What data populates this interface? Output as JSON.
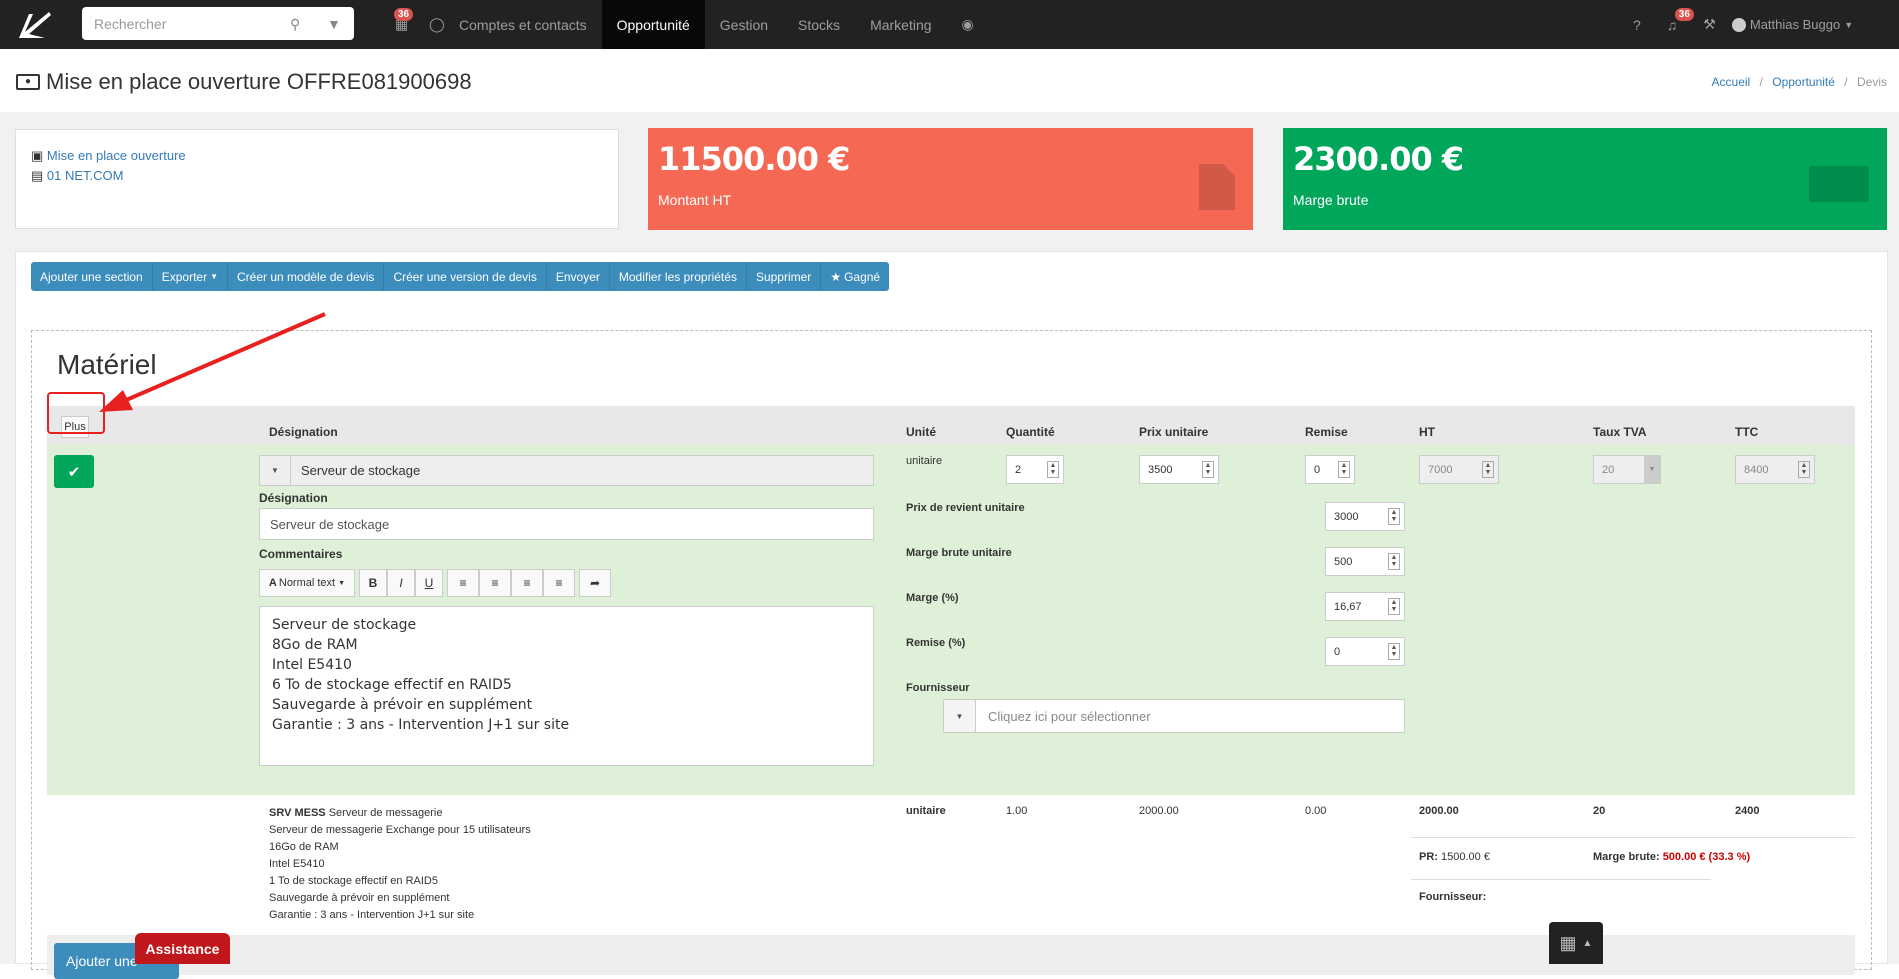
{
  "topbar": {
    "search_placeholder": "Rechercher",
    "calendar_badge": "36",
    "notif_badge": "36",
    "nav": [
      "Comptes et contacts",
      "Opportunité",
      "Gestion",
      "Stocks",
      "Marketing"
    ],
    "active_nav": "Opportunité",
    "user": "Matthias Buggo"
  },
  "header": {
    "title": "Mise en place ouverture OFFRE081900698",
    "breadcrumb": [
      "Accueil",
      "Opportunité",
      "Devis"
    ]
  },
  "info": {
    "opportunity_link": "Mise en place ouverture",
    "company_link": "01 NET.COM"
  },
  "stats": {
    "amount_value": "11500.00 €",
    "amount_label": "Montant HT",
    "amount_color": "#f56954",
    "margin_value": "2300.00 €",
    "margin_label": "Marge brute",
    "margin_color": "#00a65a"
  },
  "toolbar": {
    "buttons": [
      "Ajouter une section",
      "Exporter",
      "Créer un modèle de devis",
      "Créer une version de devis",
      "Envoyer",
      "Modifier les propriétés",
      "Supprimer",
      "Gagné"
    ]
  },
  "section": {
    "title": "Matériel",
    "plus_label": "Plus",
    "columns": [
      "Désignation",
      "Unité",
      "Quantité",
      "Prix unitaire",
      "Remise",
      "HT",
      "Taux TVA",
      "TTC"
    ]
  },
  "edit_row": {
    "product_select": "Serveur de stockage",
    "designation_label": "Désignation",
    "designation_value": "Serveur de stockage",
    "comments_label": "Commentaires",
    "rte_normal": "Normal text",
    "comment_lines": [
      "Serveur de stockage",
      "8Go de RAM",
      "Intel E5410",
      "6 To de stockage effectif en RAID5",
      "Sauvegarde à prévoir en supplément",
      "Garantie : 3 ans - Intervention J+1 sur site"
    ],
    "unit": "unitaire",
    "quantity": "2",
    "unit_price": "3500",
    "discount": "0",
    "ht": "7000",
    "vat": "20",
    "ttc": "8400",
    "cost_label": "Prix de revient unitaire",
    "cost_value": "3000",
    "margin_unit_label": "Marge brute unitaire",
    "margin_unit_value": "500",
    "margin_pct_label": "Marge (%)",
    "margin_pct_value": "16,67",
    "discount_pct_label": "Remise (%)",
    "discount_pct_value": "0",
    "supplier_label": "Fournisseur",
    "supplier_placeholder": "Cliquez ici pour sélectionner"
  },
  "view_row": {
    "code": "SRV MESS",
    "name": "Serveur de messagerie",
    "lines": [
      "Serveur de messagerie Exchange pour 15 utilisateurs",
      "16Go de RAM",
      "Intel E5410",
      "1 To de stockage effectif en RAID5",
      "Sauvegarde à prévoir en supplément",
      "Garantie : 3 ans - Intervention J+1 sur site"
    ],
    "unit": "unitaire",
    "quantity": "1.00",
    "unit_price": "2000.00",
    "discount": "0.00",
    "ht": "2000.00",
    "vat": "20",
    "ttc": "2400",
    "pr_label": "PR:",
    "pr_value": "1500.00 €",
    "margin_label": "Marge brute:",
    "margin_value": "500.00 € (33.3 %)",
    "supplier_label": "Fournisseur:"
  },
  "bottom": {
    "add_button": "Ajouter une",
    "assistance": "Assistance"
  }
}
